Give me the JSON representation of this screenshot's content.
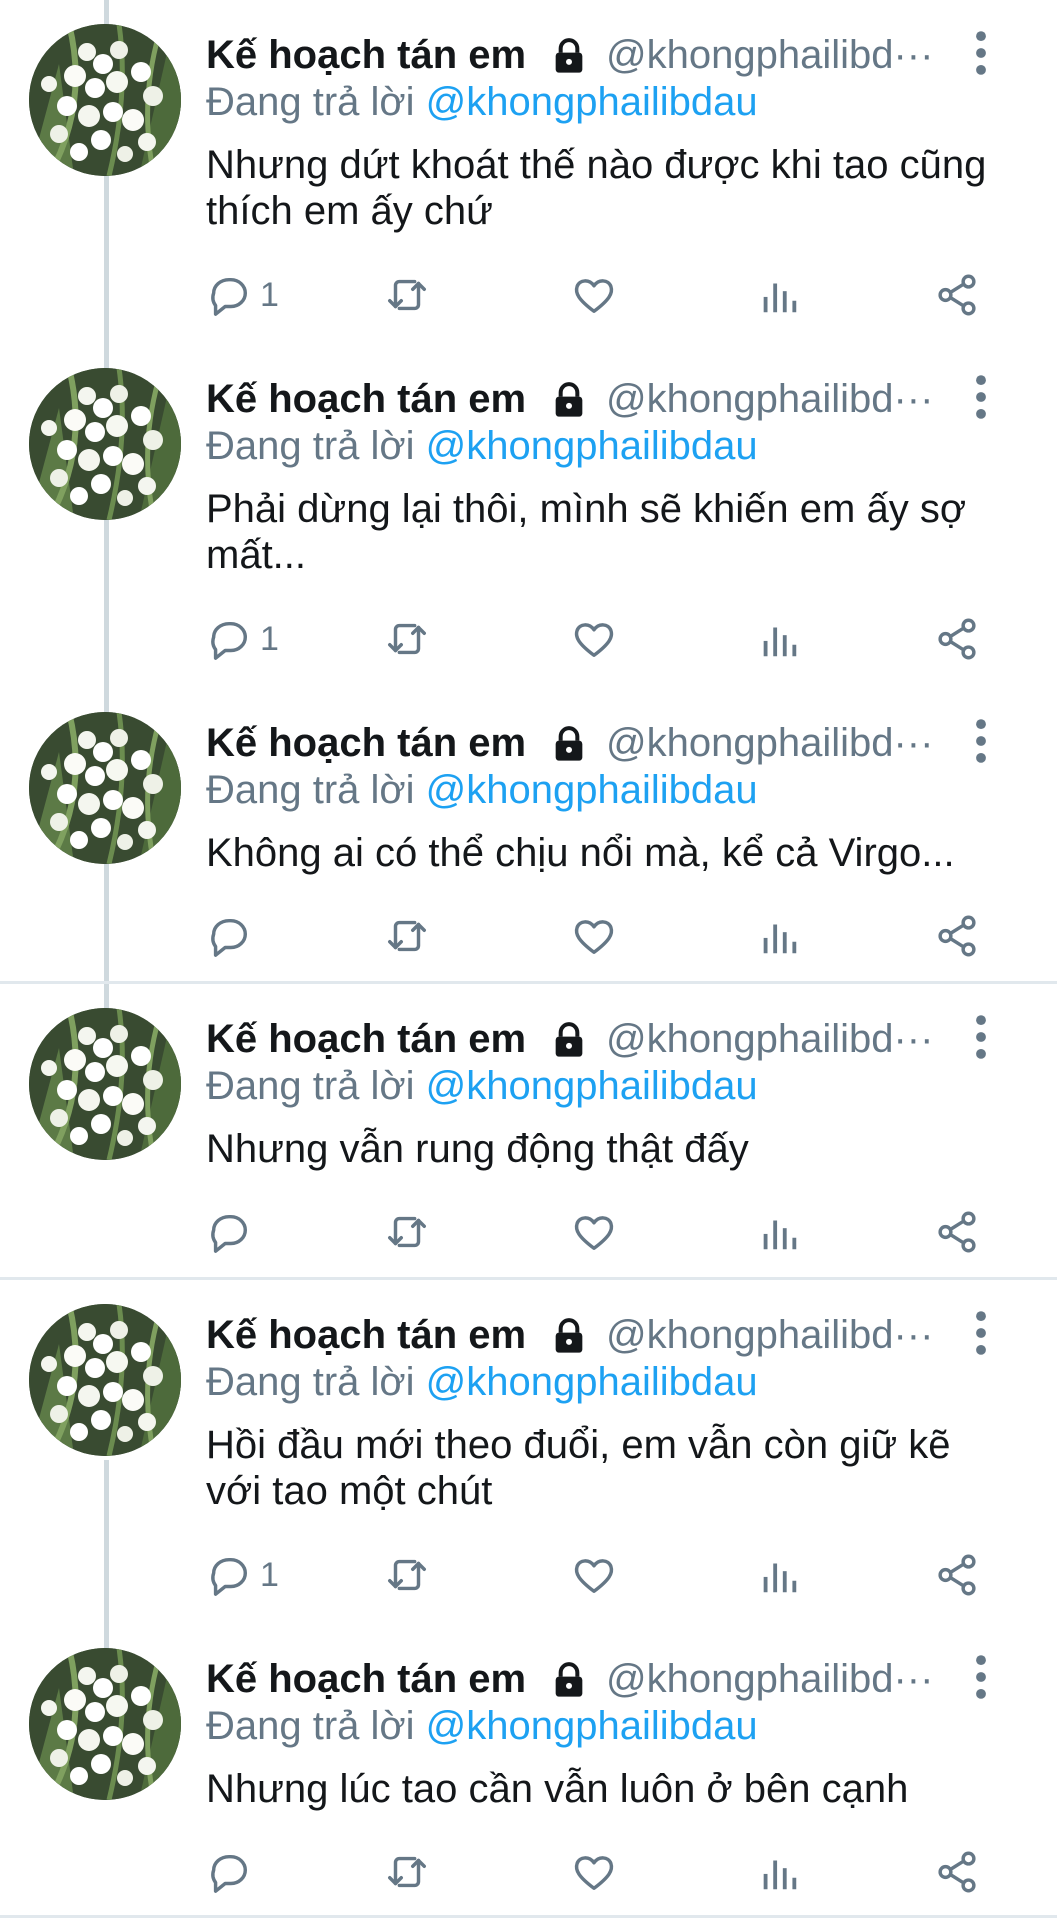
{
  "colors": {
    "accent": "#1da1f2",
    "muted": "#657786",
    "text": "#14171a",
    "thread_line": "#cfd9de",
    "divider": "#e1e8ed"
  },
  "author": {
    "name": "Kế hoạch tán em",
    "handle": "@khongphailibd···",
    "lock_icon": "lock-icon",
    "avatar_icon": "lily-of-the-valley-avatar"
  },
  "reply_prefix": "Đang trả lời",
  "reply_handle": "@khongphailibdau",
  "tweets": [
    {
      "text": "Nhưng dứt khoát thế nào được khi tao cũng thích em ấy chứ",
      "replies": "1"
    },
    {
      "text": "Phải dừng lại thôi, mình sẽ khiến em ấy sợ mất...",
      "replies": "1"
    },
    {
      "text": "Không ai có thể chịu nổi mà, kể cả Virgo...",
      "replies": ""
    },
    {
      "text": "Nhưng vẫn rung động thật đấy",
      "replies": ""
    },
    {
      "text": "Hồi đầu mới theo đuổi, em vẫn còn giữ kẽ với tao một chút",
      "replies": "1"
    },
    {
      "text": "Nhưng lúc tao cần vẫn luôn ở bên cạnh",
      "replies": ""
    }
  ],
  "icons": {
    "reply": "reply-icon",
    "retweet": "retweet-icon",
    "like": "heart-icon",
    "stats": "analytics-icon",
    "share": "share-icon",
    "more": "more-vertical-icon"
  }
}
